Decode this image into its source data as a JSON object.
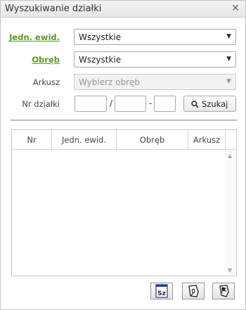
{
  "window": {
    "title": "Wyszukiwanie działki",
    "close_icon": "close-icon"
  },
  "form": {
    "jedn_label": "Jedn. ewid.",
    "jedn_value": "Wszystkie",
    "obreb_label": "Obręb",
    "obreb_value": "Wszystkie",
    "arkusz_label": "Arkusz",
    "arkusz_placeholder": "Wybierz obręb",
    "nr_label": "Nr działki",
    "separator_slash": "/",
    "separator_dash": "-",
    "search_button": "Szukaj"
  },
  "table": {
    "columns": [
      "Nr",
      "Jedn. ewid.",
      "Obręb",
      "Arkusz"
    ],
    "rows": []
  },
  "toolbar": {
    "buttons": [
      {
        "icon": "sz-export-icon",
        "label": "Sz"
      },
      {
        "icon": "map-select-icon"
      },
      {
        "icon": "map-flag-icon"
      }
    ]
  },
  "colors": {
    "link": "#5a9a1e",
    "border": "#aaaaaa"
  }
}
